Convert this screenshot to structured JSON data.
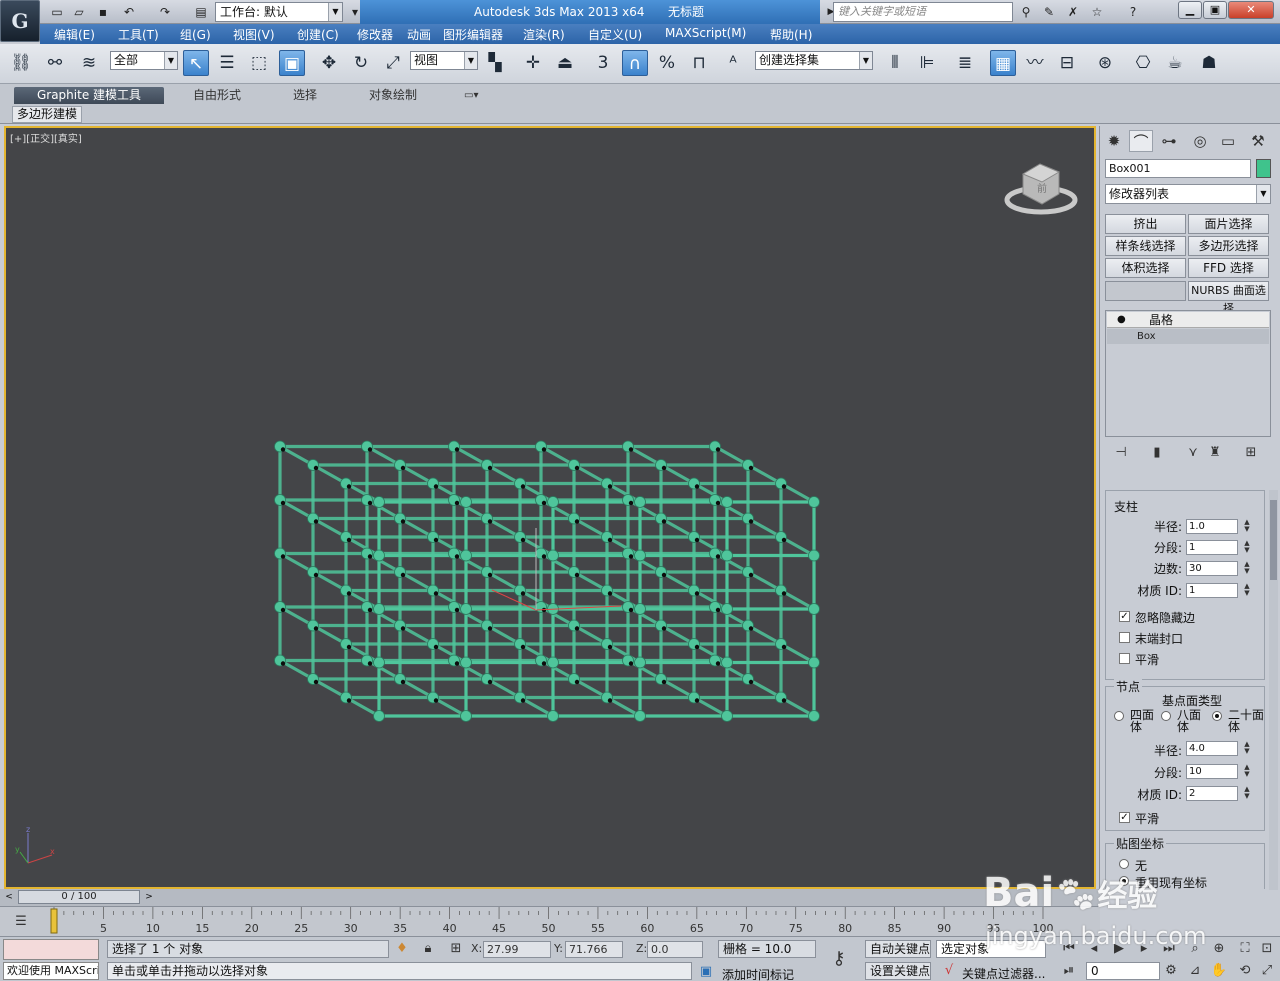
{
  "app": {
    "logo_glyph": "G",
    "workspace_label": "工作台: 默认",
    "title": "Autodesk 3ds Max  2013 x64",
    "file_title": "无标题",
    "search_placeholder": "键入关键字或短语"
  },
  "menu": [
    "编辑(E)",
    "工具(T)",
    "组(G)",
    "视图(V)",
    "创建(C)",
    "修改器",
    "动画",
    "图形编辑器",
    "渲染(R)",
    "自定义(U)",
    "MAXScript(M)",
    "帮助(H)"
  ],
  "toolbar": {
    "filter_value": "全部",
    "refcoord_value": "视图",
    "snaps_label": "3",
    "named_selection_value": "创建选择集"
  },
  "ribbon": {
    "tabs": [
      "Graphite 建模工具",
      "自由形式",
      "选择",
      "对象绘制"
    ],
    "subtab": "多边形建模"
  },
  "viewport": {
    "label_plus": "[+]",
    "label_view": "[正交]",
    "label_shading": "[真实]",
    "viewcube_face": "前",
    "lattice_color": "#4fc59b",
    "axis_labels": [
      "x",
      "y",
      "z"
    ]
  },
  "command_panel": {
    "object_name": "Box001",
    "object_color": "#3fc38c",
    "modifier_list_label": "修改器列表",
    "modifier_buttons": [
      "挤出",
      "面片选择",
      "样条线选择",
      "多边形选择",
      "体积选择",
      "FFD 选择",
      "",
      "NURBS 曲面选择"
    ],
    "stack": [
      "晶格",
      "Box"
    ],
    "struts": {
      "title": "支柱",
      "radius_label": "半径:",
      "radius_value": "1.0",
      "segments_label": "分段:",
      "segments_value": "1",
      "sides_label": "边数:",
      "sides_value": "30",
      "matid_label": "材质 ID:",
      "matid_value": "1",
      "ignore_hidden_label": "忽略隐藏边",
      "ignore_hidden_checked": true,
      "end_caps_label": "末端封口",
      "end_caps_checked": false,
      "smooth_label": "平滑",
      "smooth_checked": false
    },
    "joints": {
      "title": "节点",
      "geodesic_label": "基点面类型",
      "types": [
        "四面体",
        "八面体",
        "二十面体"
      ],
      "selected_type": "二十面体",
      "radius_label": "半径:",
      "radius_value": "4.0",
      "segments_label": "分段:",
      "segments_value": "10",
      "matid_label": "材质 ID:",
      "matid_value": "2",
      "smooth_label": "平滑",
      "smooth_checked": true
    },
    "mapping": {
      "title": "贴图坐标",
      "options": [
        "无",
        "重用现有坐标"
      ]
    }
  },
  "timeline": {
    "frame_display": "0 / 100",
    "ticks": [
      "0",
      "5",
      "10",
      "15",
      "20",
      "25",
      "30",
      "35",
      "40",
      "45",
      "50",
      "55",
      "60",
      "65",
      "70",
      "75",
      "80",
      "85",
      "90",
      "95",
      "100"
    ]
  },
  "status": {
    "maxscript_text": "欢迎使用  MAXScri",
    "selection_text": "选择了 1 个 对象",
    "prompt_text": "单击或单击并拖动以选择对象",
    "x_value": "27.99",
    "y_value": "71.766",
    "z_value": "0.0",
    "grid_text": "栅格 = 10.0",
    "auto_key": "自动关键点",
    "set_key": "设置关键点",
    "selected_object": "选定对象",
    "key_filters": "关键点过滤器...",
    "add_time_tag": "添加时间标记",
    "frame_value": "0"
  },
  "watermark": {
    "brand": "Bai",
    "brand2": "经验",
    "url": "jingyan.baidu.com"
  }
}
